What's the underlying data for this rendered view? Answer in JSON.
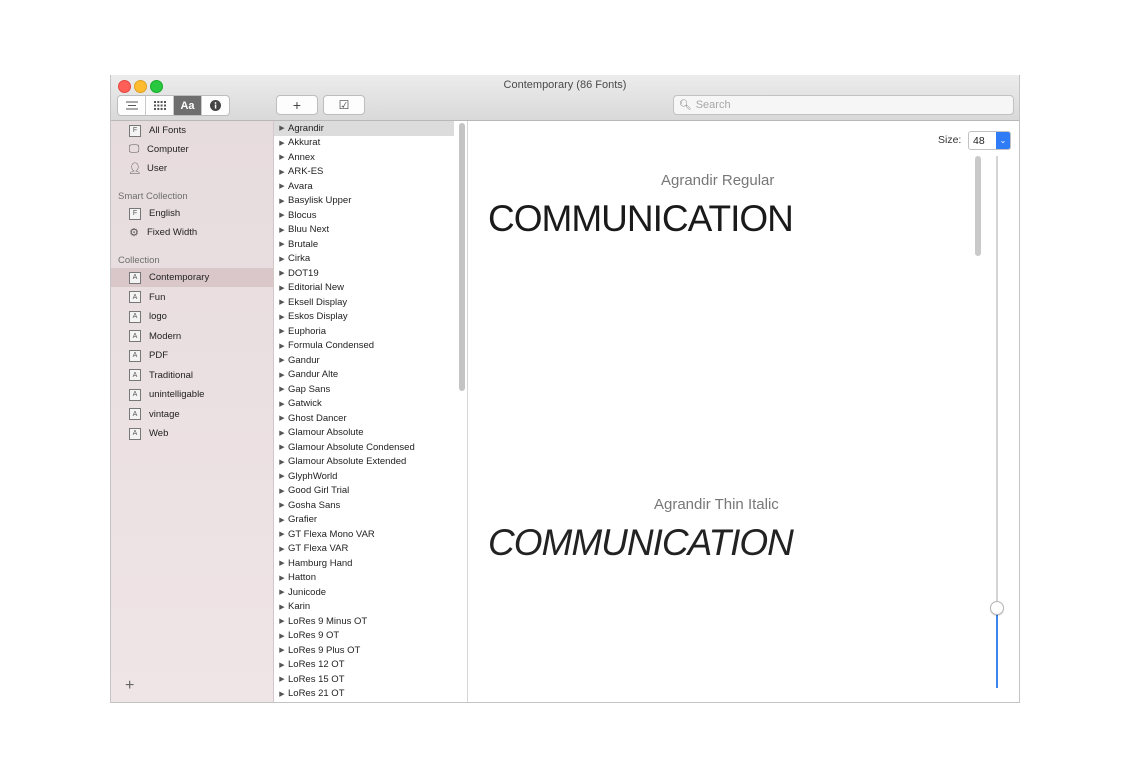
{
  "window": {
    "title": "Contemporary (86 Fonts)",
    "colors": {
      "close": "#ff5f57",
      "minimize": "#febc2e",
      "maximize": "#28c840",
      "accent": "#2f7cf6"
    }
  },
  "toolbar": {
    "view_modes": [
      {
        "icon": "list-icon"
      },
      {
        "icon": "grid-icon"
      },
      {
        "label": "Aa",
        "icon": "sample-icon"
      },
      {
        "icon": "info-icon"
      }
    ],
    "add_label": "+",
    "validate_label": "☑",
    "search": {
      "placeholder": "Search",
      "value": ""
    }
  },
  "sidebar": {
    "library": [
      {
        "label": "All Fonts",
        "icon": "font-file-icon"
      },
      {
        "label": "Computer",
        "icon": "computer-icon"
      },
      {
        "label": "User",
        "icon": "user-icon"
      }
    ],
    "smart_collection_header": "Smart Collection",
    "smart_collections": [
      {
        "label": "English",
        "icon": "font-file-icon"
      },
      {
        "label": "Fixed Width",
        "icon": "gear-icon"
      }
    ],
    "collection_header": "Collection",
    "collections": [
      {
        "label": "Contemporary",
        "selected": true
      },
      {
        "label": "Fun"
      },
      {
        "label": "logo"
      },
      {
        "label": "Modern"
      },
      {
        "label": "PDF"
      },
      {
        "label": "Traditional"
      },
      {
        "label": "unintelligable"
      },
      {
        "label": "vintage"
      },
      {
        "label": "Web"
      }
    ],
    "add_label": "+"
  },
  "font_list": [
    "Agrandir",
    "Akkurat",
    "Annex",
    "ARK-ES",
    "Avara",
    "Basylisk Upper",
    "Blocus",
    "Bluu Next",
    "Brutale",
    "Cirka",
    "DOT19",
    "Editorial New",
    "Eksell Display",
    "Eskos Display",
    "Euphoria",
    "Formula Condensed",
    "Gandur",
    "Gandur Alte",
    "Gap Sans",
    "Gatwick",
    "Ghost Dancer",
    "Glamour Absolute",
    "Glamour Absolute Condensed",
    "Glamour Absolute Extended",
    "GlyphWorld",
    "Good Girl Trial",
    "Gosha Sans",
    "Grafier",
    "GT Flexa Mono VAR",
    "GT Flexa VAR",
    "Hamburg Hand",
    "Hatton",
    "Junicode",
    "Karin",
    "LoRes 9 Minus OT",
    "LoRes 9 OT",
    "LoRes 9 Plus OT",
    "LoRes 12 OT",
    "LoRes 15 OT",
    "LoRes 21 OT"
  ],
  "font_list_selected": "Agrandir",
  "preview": {
    "size_label": "Size:",
    "size_value": "48",
    "samples": [
      {
        "name": "Agrandir Regular",
        "text": "COMMUNICATION"
      },
      {
        "name": "Agrandir Thin Italic",
        "text": "COMMUNICATION"
      }
    ]
  }
}
